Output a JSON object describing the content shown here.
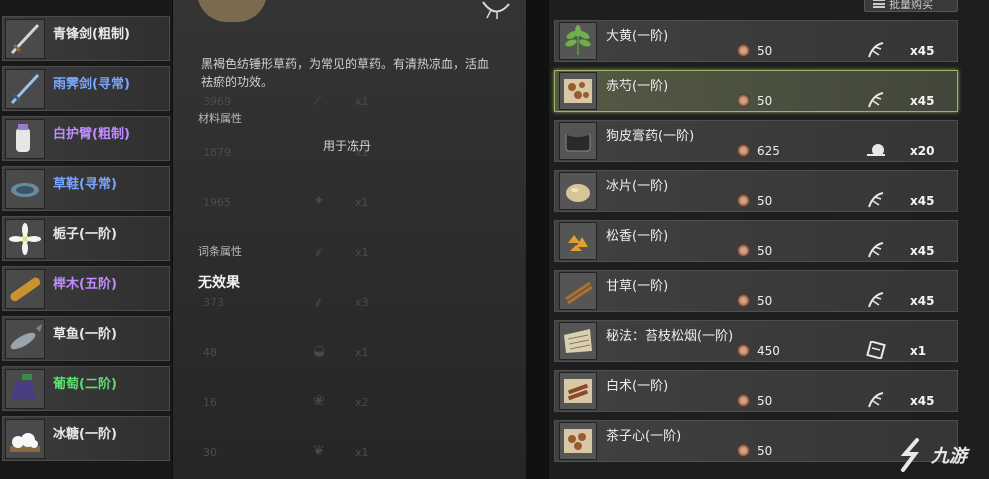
{
  "left_items": [
    {
      "name": "青锋剑(粗制)",
      "quality": "white",
      "icon": "sword-icon"
    },
    {
      "name": "雨霁剑(寻常)",
      "quality": "blue",
      "icon": "sword-icon"
    },
    {
      "name": "白护臂(粗制)",
      "quality": "purple",
      "icon": "bracer-icon"
    },
    {
      "name": "草鞋(寻常)",
      "quality": "blue",
      "icon": "sandal-icon"
    },
    {
      "name": "栀子(一阶)",
      "quality": "white",
      "icon": "flower-icon"
    },
    {
      "name": "榉木(五阶)",
      "quality": "purple",
      "icon": "wood-icon"
    },
    {
      "name": "草鱼(一阶)",
      "quality": "white",
      "icon": "fish-icon"
    },
    {
      "name": "葡萄(二阶)",
      "quality": "green",
      "icon": "grape-icon"
    },
    {
      "name": "冰糖(一阶)",
      "quality": "white",
      "icon": "sugar-icon"
    }
  ],
  "detail": {
    "description": "黑褐色纺锤形草药，为常见的草药。有清热凉血，活血祛瘀的功效。",
    "material_label": "材料属性",
    "use_text": "用于冻丹",
    "entry_label": "词条属性",
    "no_effect": "无效果"
  },
  "ghost_rows": [
    {
      "num": "3969",
      "qty": "x1"
    },
    {
      "num": "1879",
      "qty": "x1"
    },
    {
      "num": "1965",
      "qty": "x1"
    },
    {
      "num": "",
      "qty": "x1"
    },
    {
      "num": "373",
      "qty": "x3"
    },
    {
      "num": "48",
      "qty": "x1"
    },
    {
      "num": "16",
      "qty": "x2"
    },
    {
      "num": "30",
      "qty": "x1"
    }
  ],
  "shop": {
    "bulk_buy_label": "批量购买",
    "items": [
      {
        "name": "大黄(一阶)",
        "price": "50",
        "qty": "x45",
        "category": "herb-category-icon",
        "icon": "rhubarb-icon"
      },
      {
        "name": "赤芍(一阶)",
        "price": "50",
        "qty": "x45",
        "category": "herb-category-icon",
        "icon": "peony-root-icon"
      },
      {
        "name": "狗皮膏药(一阶)",
        "price": "625",
        "qty": "x20",
        "category": "medicine-category-icon",
        "icon": "plaster-icon"
      },
      {
        "name": "冰片(一阶)",
        "price": "50",
        "qty": "x45",
        "category": "herb-category-icon",
        "icon": "borneol-icon"
      },
      {
        "name": "松香(一阶)",
        "price": "50",
        "qty": "x45",
        "category": "herb-category-icon",
        "icon": "rosin-icon"
      },
      {
        "name": "甘草(一阶)",
        "price": "50",
        "qty": "x45",
        "category": "herb-category-icon",
        "icon": "licorice-icon"
      },
      {
        "name": "秘法：苔枝松烟(一阶)",
        "price": "450",
        "qty": "x1",
        "category": "recipe-category-icon",
        "icon": "scroll-icon"
      },
      {
        "name": "白术(一阶)",
        "price": "50",
        "qty": "x45",
        "category": "herb-category-icon",
        "icon": "atractylodes-icon"
      },
      {
        "name": "茶子心(一阶)",
        "price": "50",
        "qty": "",
        "category": "",
        "icon": "tea-seed-icon"
      }
    ]
  },
  "watermark": {
    "text": "九游"
  },
  "colors": {
    "quality_white": "#e8e8e8",
    "quality_blue": "#79a6ff",
    "quality_purple": "#c08cff",
    "quality_green": "#5ddd70",
    "selected_border": "#9fb46a"
  }
}
